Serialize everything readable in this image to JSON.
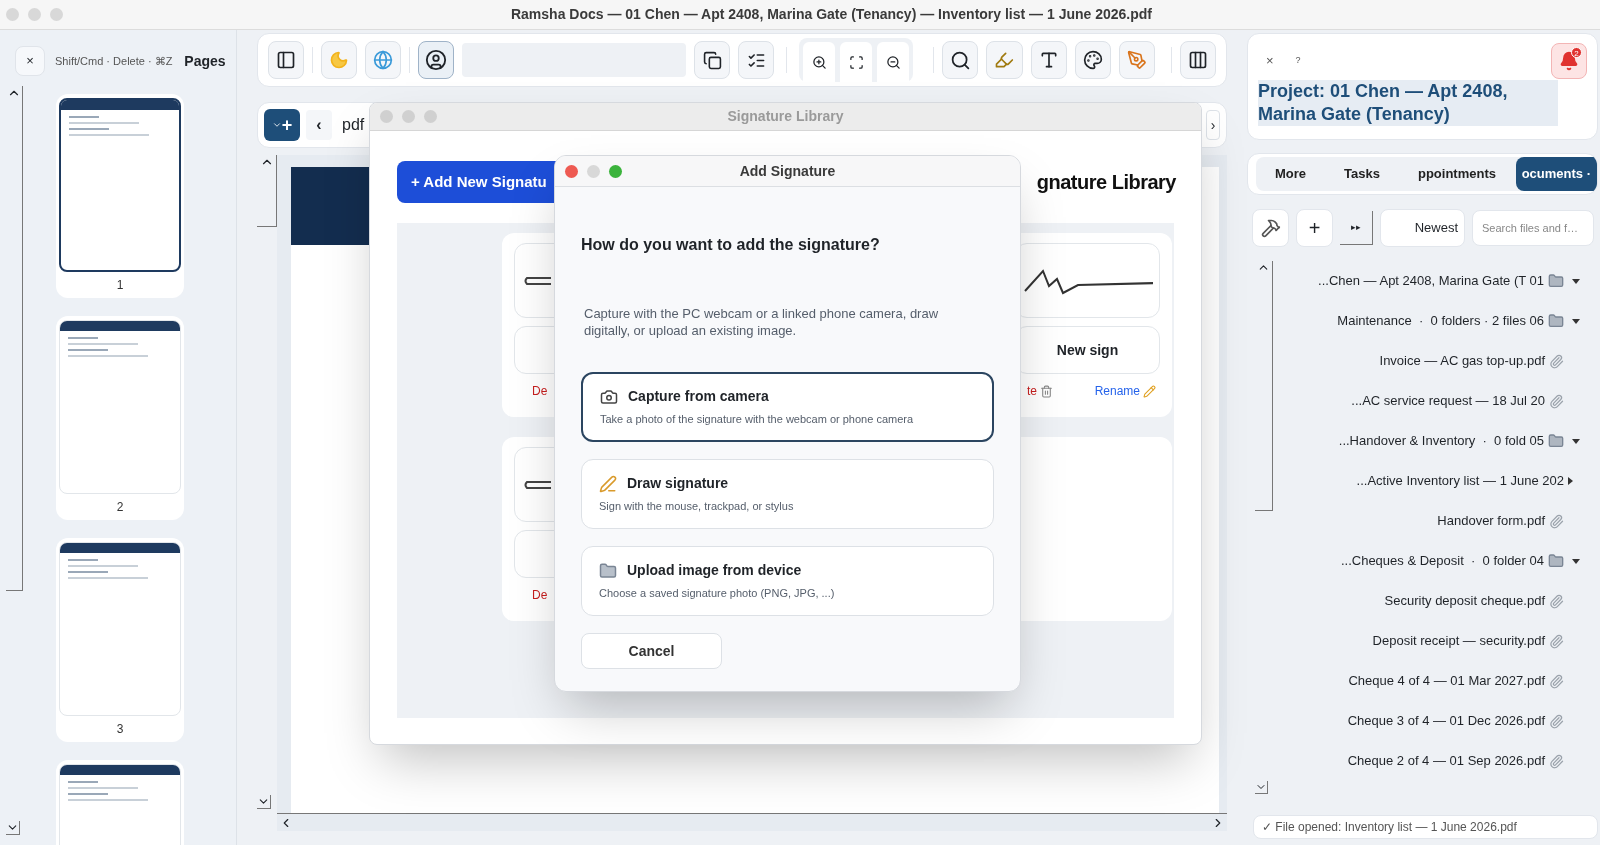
{
  "window": {
    "title": "Ramsha Docs — 01 Chen — Apt 2408, Marina Gate (Tenancy) — Inventory list — 1 June 2026.pdf"
  },
  "pages_panel": {
    "close": "×",
    "hint": "Shift/Cmd · Delete · ⌘Z",
    "title": "Pages",
    "thumbnails": [
      {
        "number": "1",
        "selected": true
      },
      {
        "number": "2",
        "selected": false
      },
      {
        "number": "3",
        "selected": false
      },
      {
        "selected": false
      }
    ]
  },
  "doc_bar": {
    "add": "+",
    "prev": "‹",
    "label": "pdf",
    "next": "›"
  },
  "signature_library": {
    "title": "Signature Library",
    "add_button": "+ Add New Signatu",
    "heading": "gnature Library",
    "rows": [
      {
        "left_delete": "De",
        "right_name": "New sign",
        "right_delete": "te",
        "right_rename": "Rename"
      },
      {
        "left_delete": "De"
      }
    ]
  },
  "add_signature": {
    "title": "Add Signature",
    "question": "How do you want to add the signature?",
    "description": "Capture with the PC webcam or a linked phone camera, draw digitally, or upload an existing image.",
    "options": [
      {
        "kind": "camera",
        "title": "Capture from camera",
        "subtitle": "Take a photo of the signature with the webcam or phone camera",
        "selected": true
      },
      {
        "kind": "draw",
        "title": "Draw signature",
        "subtitle": "Sign with the mouse, trackpad, or stylus",
        "selected": false
      },
      {
        "kind": "upload",
        "title": "Upload image from device",
        "subtitle": "Choose a saved signature photo (PNG, JPG, ...)",
        "selected": false
      }
    ],
    "cancel": "Cancel"
  },
  "project_panel": {
    "close": "×",
    "help": "?",
    "notifications": "2",
    "title": "Project: 01 Chen — Apt 2408, Marina Gate (Tenancy)"
  },
  "tabs": [
    {
      "label": "More",
      "selected": false
    },
    {
      "label": "Tasks",
      "selected": false
    },
    {
      "label": "ppointments",
      "selected": false
    },
    {
      "label": "ocuments ·",
      "selected": true
    }
  ],
  "files_toolbar": {
    "add": "+",
    "skip": "▸▸",
    "sort": "Newest",
    "search_placeholder": "Search files and f…"
  },
  "tree": [
    {
      "label": "...Chen — Apt 2408, Marina Gate (T 01",
      "kind": "folder",
      "expanded": true,
      "children": [
        {
          "label": "Maintenance  ·  0 folders · 2 files 06",
          "kind": "folder",
          "expanded": true,
          "children": [
            {
              "label": "Invoice — AC gas top-up.pdf",
              "kind": "file"
            },
            {
              "label": "...AC service request — 18 Jul 20",
              "kind": "file"
            }
          ]
        },
        {
          "label": "...Handover & Inventory  ·  0 fold 05",
          "kind": "folder",
          "expanded": true,
          "children": [
            {
              "label": "...Active Inventory list — 1 June 202",
              "kind": "group",
              "expanded": false
            },
            {
              "label": "Handover form.pdf",
              "kind": "file"
            }
          ]
        },
        {
          "label": "...Cheques & Deposit  ·  0 folder 04",
          "kind": "folder",
          "expanded": true,
          "children": [
            {
              "label": "Security deposit cheque.pdf",
              "kind": "file"
            },
            {
              "label": "Deposit receipt — security.pdf",
              "kind": "file"
            },
            {
              "label": "Cheque 4 of 4 — 01 Mar 2027.pdf",
              "kind": "file"
            },
            {
              "label": "Cheque 3 of 4 — 01 Dec 2026.pdf",
              "kind": "file"
            },
            {
              "label": "Cheque 2 of 4 — 01 Sep 2026.pdf",
              "kind": "file"
            }
          ]
        }
      ]
    }
  ],
  "status": "✓ File opened: Inventory list — 1 June 2026.pdf"
}
